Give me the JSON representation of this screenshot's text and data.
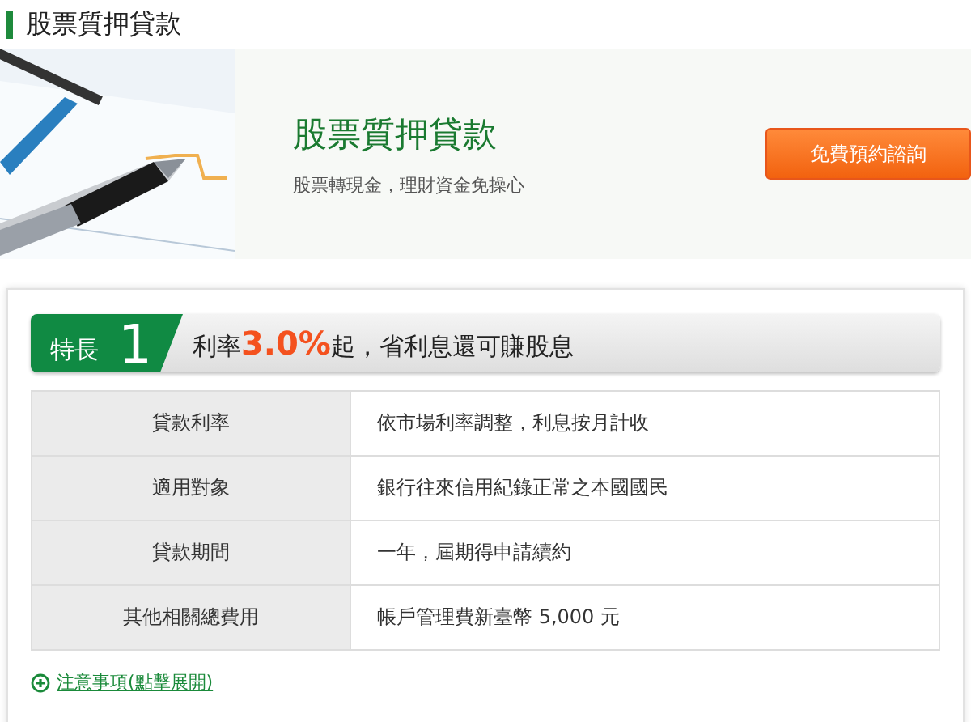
{
  "page_title": "股票質押貸款",
  "hero": {
    "title": "股票質押貸款",
    "subtitle": "股票轉現金，理財資金免操心",
    "button": "免費預約諮詢"
  },
  "feature": {
    "tag": "特長",
    "number": "1",
    "headline": "利率**3.0%**起，省利息還可賺股息"
  },
  "table": {
    "rows": [
      {
        "label": "貸款利率",
        "value": "依市場利率調整，利息按月計收"
      },
      {
        "label": "適用對象",
        "value": "銀行往來信用紀錄正常之本國國民"
      },
      {
        "label": "貸款期間",
        "value": "一年，屆期得申請續約"
      },
      {
        "label": "其他相關總費用",
        "value": "帳戶管理費新臺幣 5,000 元"
      }
    ]
  },
  "notice_link": {
    "text": "注意事項(點擊展開)",
    "expanded": false
  }
}
